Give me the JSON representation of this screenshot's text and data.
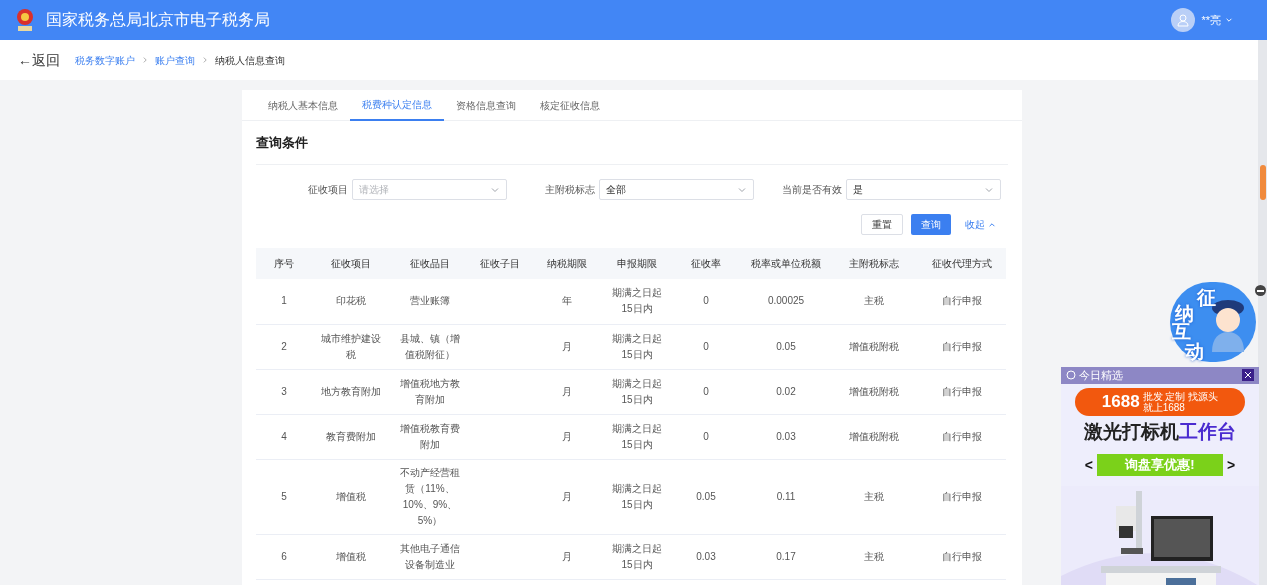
{
  "header": {
    "title": "国家税务总局北京市电子税务局",
    "user": "**亮"
  },
  "breadcrumb": {
    "back": "←返回",
    "items": [
      {
        "label": "税务数字账户",
        "current": false
      },
      {
        "label": "账户查询",
        "current": false
      },
      {
        "label": "纳税人信息查询",
        "current": true
      }
    ]
  },
  "tabs": [
    {
      "label": "纳税人基本信息",
      "selected": false
    },
    {
      "label": "税费种认定信息",
      "selected": true
    },
    {
      "label": "资格信息查询",
      "selected": false
    },
    {
      "label": "核定征收信息",
      "selected": false
    }
  ],
  "section_title": "查询条件",
  "filters": [
    {
      "label": "征收项目",
      "placeholder": "请选择"
    },
    {
      "label": "主附税标志",
      "value": "全部"
    },
    {
      "label": "当前是否有效",
      "value": "是"
    }
  ],
  "buttons": {
    "reset": "重置",
    "query": "查询",
    "collapse": "收起"
  },
  "table": {
    "columns": [
      "序号",
      "征收项目",
      "征收品目",
      "征收子目",
      "纳税期限",
      "申报期限",
      "征收率",
      "税率或单位税额",
      "主附税标志",
      "征收代理方式"
    ],
    "rows": [
      [
        "1",
        "印花税",
        "营业账簿",
        "",
        "年",
        "期满之日起15日内",
        "0",
        "0.00025",
        "主税",
        "自行申报"
      ],
      [
        "2",
        "城市维护建设税",
        "县城、镇（增值税附征）",
        "",
        "月",
        "期满之日起15日内",
        "0",
        "0.05",
        "增值税附税",
        "自行申报"
      ],
      [
        "3",
        "地方教育附加",
        "增值税地方教育附加",
        "",
        "月",
        "期满之日起15日内",
        "0",
        "0.02",
        "增值税附税",
        "自行申报"
      ],
      [
        "4",
        "教育费附加",
        "增值税教育费附加",
        "",
        "月",
        "期满之日起15日内",
        "0",
        "0.03",
        "增值税附税",
        "自行申报"
      ],
      [
        "5",
        "增值税",
        "不动产经营租赁（11%、10%、9%、5%）",
        "",
        "月",
        "期满之日起15日内",
        "0.05",
        "0.11",
        "主税",
        "自行申报"
      ],
      [
        "6",
        "增值税",
        "其他电子通信设备制造业",
        "",
        "月",
        "期满之日起15日内",
        "0.03",
        "0.17",
        "主税",
        "自行申报"
      ]
    ]
  },
  "assistant_badge": {
    "chars": [
      "征",
      "纳",
      "互",
      "动"
    ]
  },
  "ad": {
    "header": "今日精选",
    "brand": "1688",
    "brand_tagline": [
      "批发 定制 找源头",
      "就上1688"
    ],
    "headline_dark": "激光打标机",
    "headline_accent": "工作台",
    "cta": "询盘享优惠!",
    "prev": "<",
    "next": ">"
  }
}
